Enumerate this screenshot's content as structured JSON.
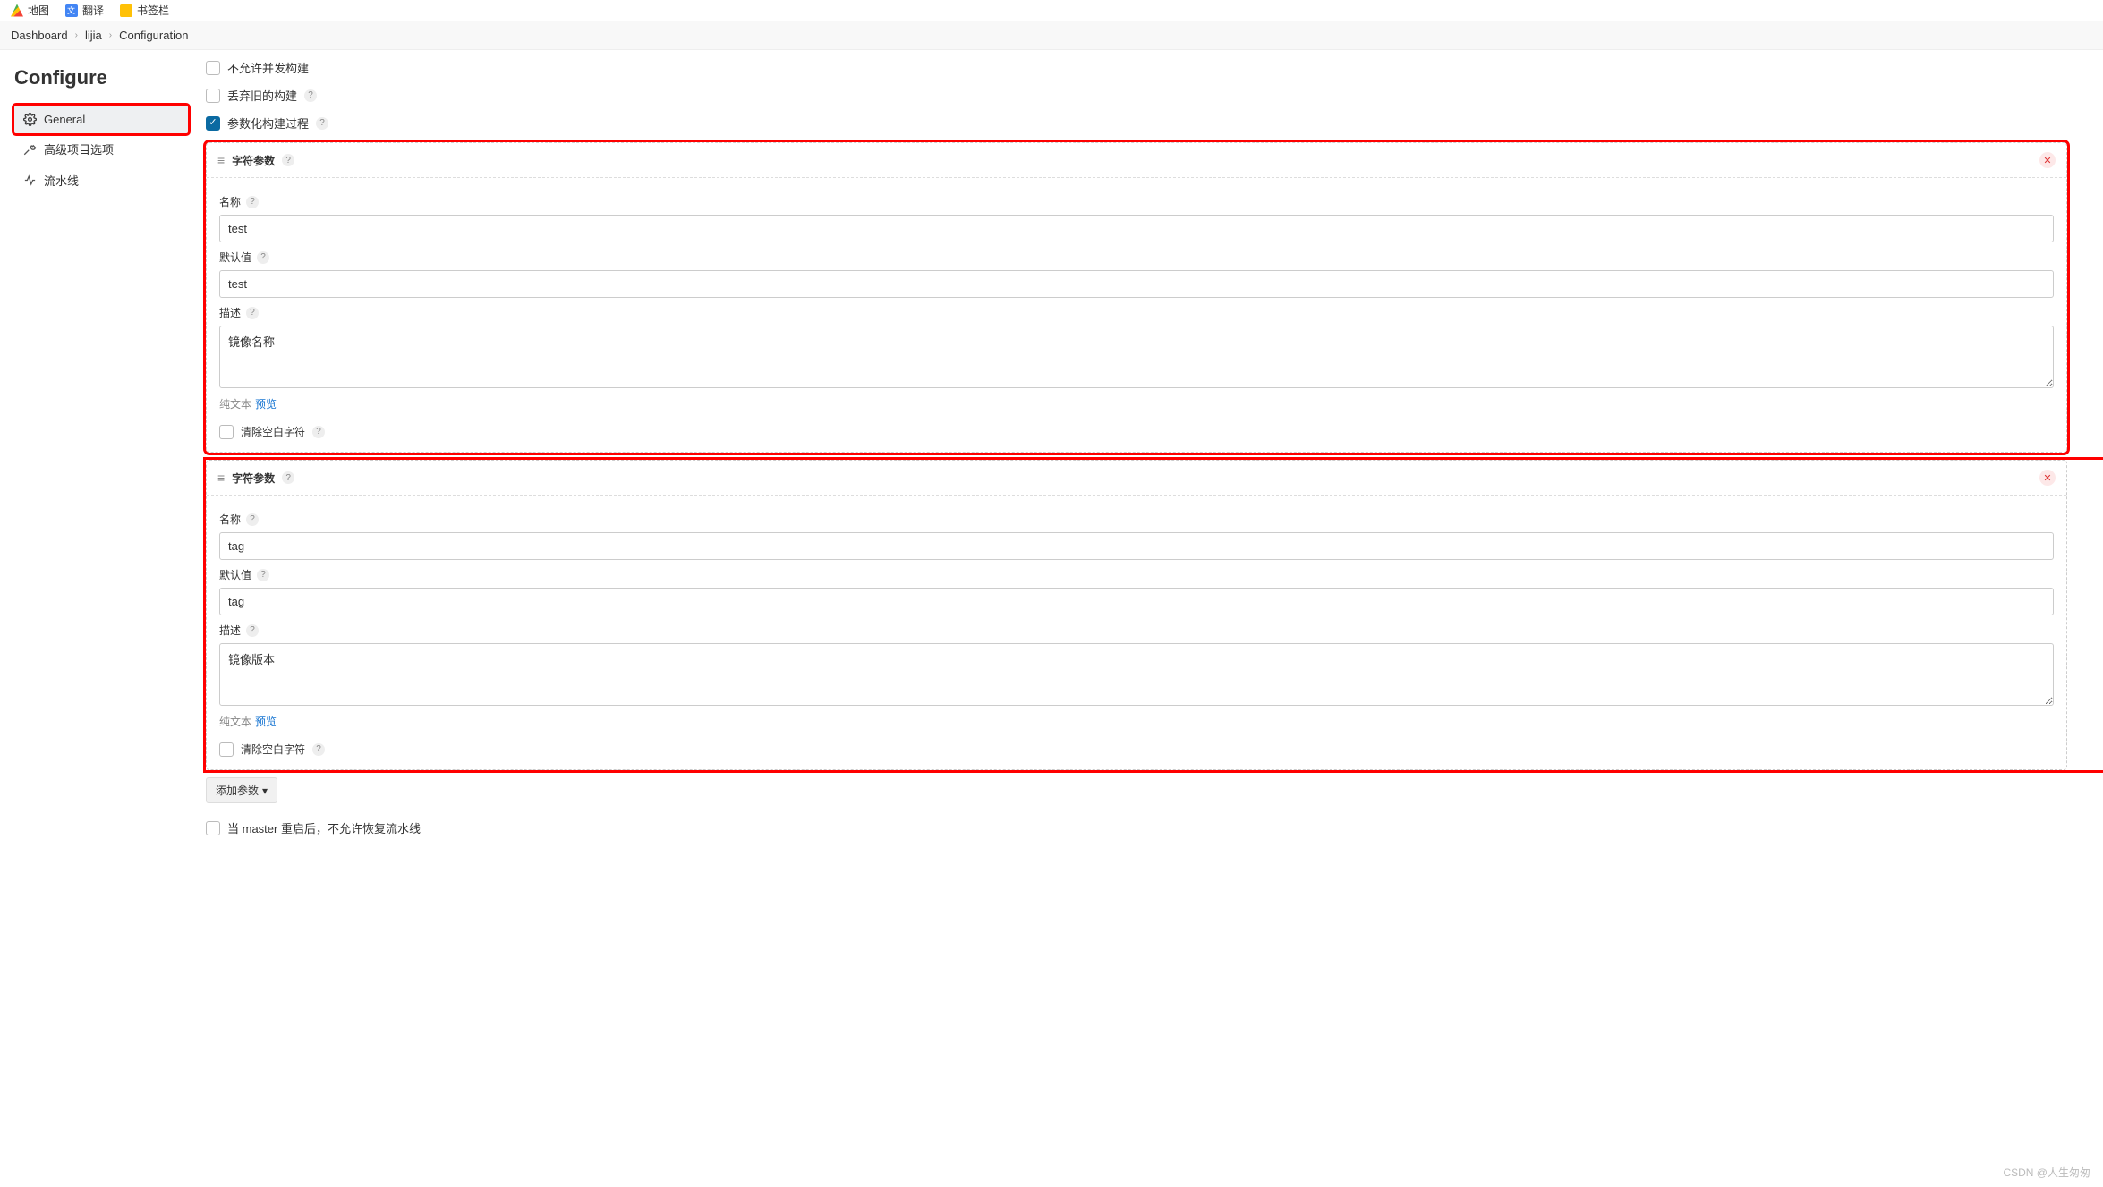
{
  "bookmarks": {
    "map": "地图",
    "translate": "翻译",
    "folder": "书签栏"
  },
  "breadcrumb": {
    "a": "Dashboard",
    "b": "lijia",
    "c": "Configuration"
  },
  "page_title": "Configure",
  "sidebar": {
    "general": "General",
    "advanced": "高级项目选项",
    "pipeline": "流水线"
  },
  "opts": {
    "no_concurrent": "不允许并发构建",
    "discard_old": "丢弃旧的构建",
    "parameterize": "参数化构建过程",
    "no_resume": "当 master 重启后，不允许恢复流水线"
  },
  "param_common": {
    "section_title": "字符参数",
    "name_label": "名称",
    "default_label": "默认值",
    "desc_label": "描述",
    "plaintext": "纯文本",
    "preview": "预览",
    "trim": "清除空白字符"
  },
  "params": [
    {
      "name": "test",
      "default": "test",
      "desc": "镜像名称"
    },
    {
      "name": "tag",
      "default": "tag",
      "desc": "镜像版本"
    }
  ],
  "add_param": "添加参数",
  "watermark": "CSDN @人生匆匆"
}
